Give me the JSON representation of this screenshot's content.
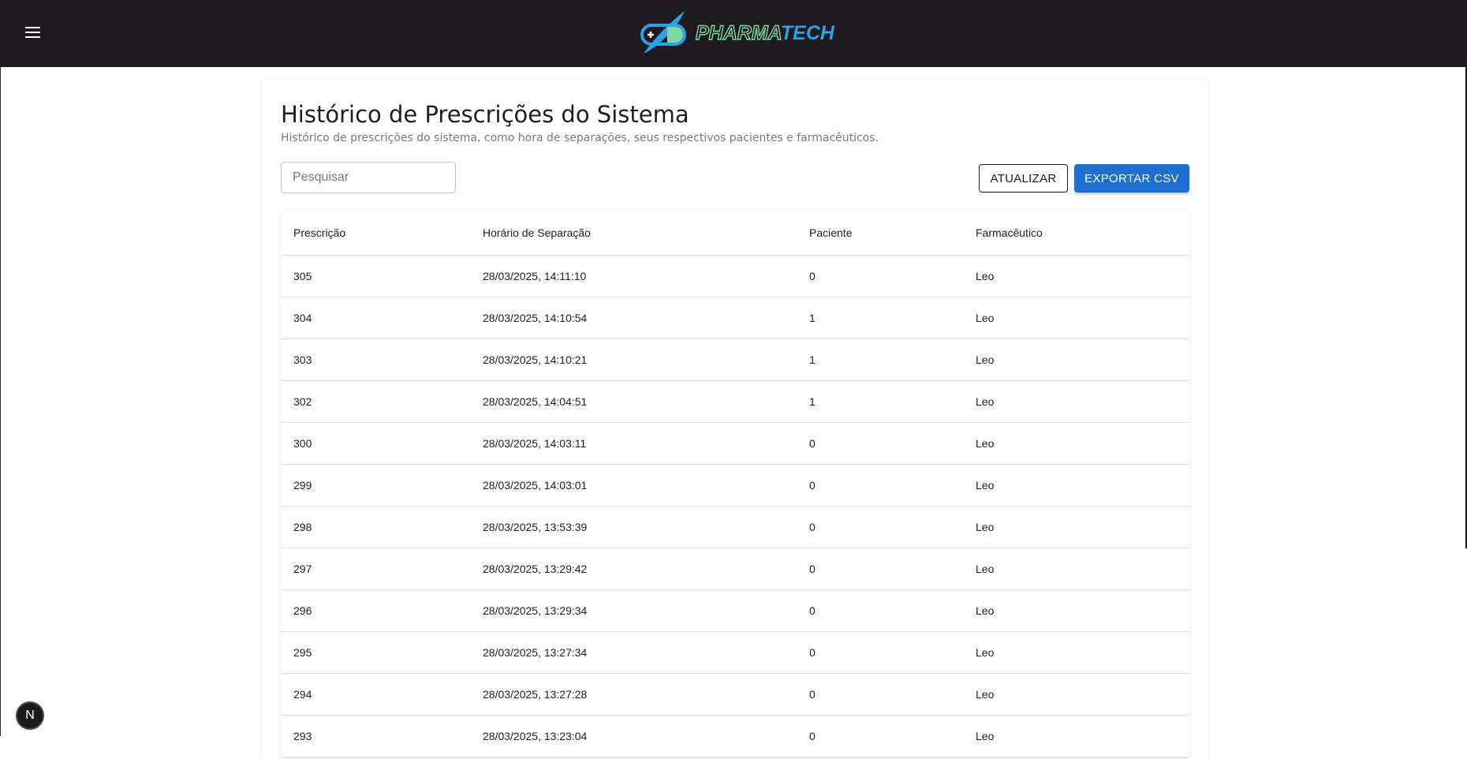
{
  "header": {
    "logo_part1": "PHARMA",
    "logo_part2": "TECH",
    "icons": {
      "menu": "hamburger-menu-icon",
      "logo": "pill-rocket-logo"
    },
    "colors": {
      "background": "#1d1b1e",
      "logo_green": "#7fd6a0",
      "logo_blue": "#2aa3e6"
    }
  },
  "page": {
    "title": "Histórico de Prescrições do Sistema",
    "subtitle": "Histórico de prescrições do sistema, como hora de separações, seus respectivos pacientes e farmacêuticos."
  },
  "toolbar": {
    "search_placeholder": "Pesquisar",
    "refresh_label": "ATUALIZAR",
    "export_label": "EXPORTAR CSV",
    "colors": {
      "primary": "#1d6fd1"
    }
  },
  "table": {
    "columns": [
      "Prescrição",
      "Horário de Separação",
      "Paciente",
      "Farmacêutico"
    ],
    "rows": [
      [
        "305",
        "28/03/2025, 14:11:10",
        "0",
        "Leo"
      ],
      [
        "304",
        "28/03/2025, 14:10:54",
        "1",
        "Leo"
      ],
      [
        "303",
        "28/03/2025, 14:10:21",
        "1",
        "Leo"
      ],
      [
        "302",
        "28/03/2025, 14:04:51",
        "1",
        "Leo"
      ],
      [
        "300",
        "28/03/2025, 14:03:11",
        "0",
        "Leo"
      ],
      [
        "299",
        "28/03/2025, 14:03:01",
        "0",
        "Leo"
      ],
      [
        "298",
        "28/03/2025, 13:53:39",
        "0",
        "Leo"
      ],
      [
        "297",
        "28/03/2025, 13:29:42",
        "0",
        "Leo"
      ],
      [
        "296",
        "28/03/2025, 13:29:34",
        "0",
        "Leo"
      ],
      [
        "295",
        "28/03/2025, 13:27:34",
        "0",
        "Leo"
      ],
      [
        "294",
        "28/03/2025, 13:27:28",
        "0",
        "Leo"
      ],
      [
        "293",
        "28/03/2025, 13:23:04",
        "0",
        "Leo"
      ]
    ]
  },
  "dev_badge": {
    "label": "N"
  }
}
